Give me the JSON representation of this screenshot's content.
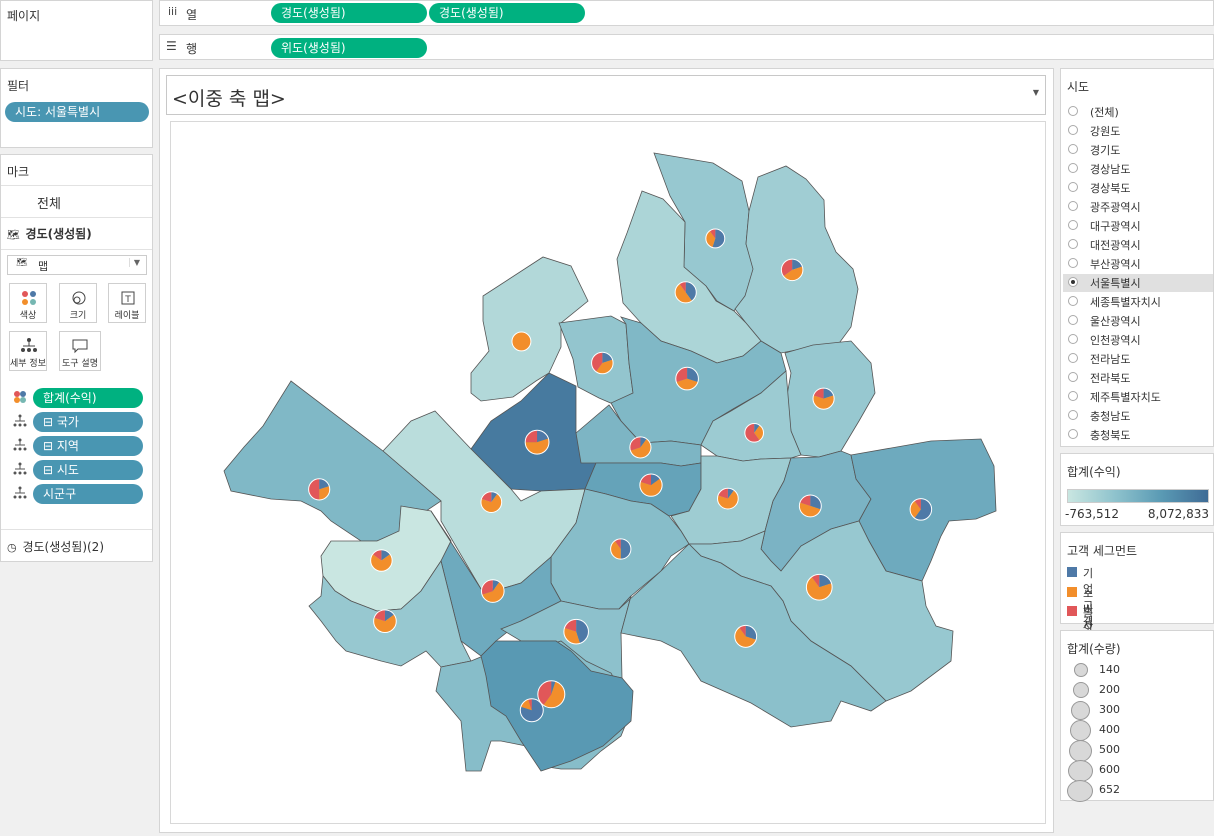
{
  "pages": {
    "label": "페이지"
  },
  "filters": {
    "title": "필터",
    "items": [
      "시도: 서울특별시"
    ]
  },
  "marks": {
    "title": "마크",
    "all_label": "전체",
    "layer_label": "경도(생성됨)",
    "mark_type": "맵",
    "buttons": [
      "색상",
      "크기",
      "레이블",
      "세부 정보",
      "도구 설명"
    ],
    "fields": [
      "합계(수익)",
      "⊟ 국가",
      "⊟ 지역",
      "⊟ 시도",
      "시군구"
    ],
    "footer_label": "경도(생성됨)(2)"
  },
  "columns": {
    "label": "열",
    "pills": [
      "경도(생성됨)",
      "경도(생성됨)"
    ]
  },
  "rows": {
    "label": "행",
    "pills": [
      "위도(생성됨)"
    ]
  },
  "sheet": {
    "title": "<이중 축 맵>"
  },
  "sido_filter": {
    "title": "시도",
    "options": [
      "(전체)",
      "강원도",
      "경기도",
      "경상남도",
      "경상북도",
      "광주광역시",
      "대구광역시",
      "대전광역시",
      "부산광역시",
      "서울특별시",
      "세종특별자치시",
      "울산광역시",
      "인천광역시",
      "전라남도",
      "전라북도",
      "제주특별자치도",
      "충청남도",
      "충청북도"
    ],
    "selected": "서울특별시"
  },
  "profit_legend": {
    "title": "합계(수익)",
    "min": "-763,512",
    "max": "8,072,833",
    "color_low": "#c9e6e1",
    "color_high": "#4a7096"
  },
  "segment_legend": {
    "title": "고객 세그먼트",
    "items": [
      {
        "label": "기업 고객",
        "color": "#4e79a7"
      },
      {
        "label": "소비자",
        "color": "#f28e2b"
      },
      {
        "label": "홈 오피스",
        "color": "#e15759"
      }
    ]
  },
  "quantity_legend": {
    "title": "합계(수량)",
    "items": [
      "140",
      "200",
      "300",
      "400",
      "500",
      "600",
      "652"
    ]
  },
  "colors": {
    "accent_green": "#00b180",
    "pill_blue": "#4996b2"
  },
  "chart_data": {
    "type": "map",
    "segments": [
      "기업 고객",
      "소비자",
      "홈 오피스"
    ],
    "districts": [
      {
        "profit": 1800000,
        "pie": [
          0.55,
          0.35,
          0.1
        ],
        "qty": 180
      },
      {
        "profit": 1300000,
        "pie": [
          0.2,
          0.45,
          0.35
        ],
        "qty": 300
      },
      {
        "profit": 700000,
        "pie": [
          0.4,
          0.5,
          0.1
        ],
        "qty": 280
      },
      {
        "profit": 400000,
        "pie": [
          0.0,
          1.0,
          0.0
        ],
        "qty": 180
      },
      {
        "profit": 2000000,
        "pie": [
          0.2,
          0.4,
          0.4
        ],
        "qty": 300
      },
      {
        "profit": 3000000,
        "pie": [
          0.3,
          0.4,
          0.3
        ],
        "qty": 360
      },
      {
        "profit": 1800000,
        "pie": [
          0.2,
          0.6,
          0.2
        ],
        "qty": 280
      },
      {
        "profit": 1500000,
        "pie": [
          0.1,
          0.3,
          0.6
        ],
        "qty": 170
      },
      {
        "profit": 7200000,
        "pie": [
          0.2,
          0.55,
          0.25
        ],
        "qty": 430
      },
      {
        "profit": 0,
        "pie": [
          0.1,
          0.7,
          0.2
        ],
        "qty": 260
      },
      {
        "profit": 3200000,
        "pie": [
          0.1,
          0.6,
          0.3
        ],
        "qty": 280
      },
      {
        "profit": 3000000,
        "pie": [
          0.2,
          0.3,
          0.5
        ],
        "qty": 280
      },
      {
        "profit": 4500000,
        "pie": [
          0.15,
          0.65,
          0.2
        ],
        "qty": 340
      },
      {
        "profit": 1400000,
        "pie": [
          0.1,
          0.7,
          0.2
        ],
        "qty": 260
      },
      {
        "profit": 3300000,
        "pie": [
          0.3,
          0.5,
          0.2
        ],
        "qty": 320
      },
      {
        "profit": 4000000,
        "pie": [
          0.6,
          0.3,
          0.1
        ],
        "qty": 300
      },
      {
        "profit": 2600000,
        "pie": [
          0.5,
          0.4,
          0.1
        ],
        "qty": 240
      },
      {
        "profit": -763512,
        "pie": [
          0.15,
          0.7,
          0.15
        ],
        "qty": 300
      },
      {
        "profit": 4000000,
        "pie": [
          0.1,
          0.6,
          0.3
        ],
        "qty": 360
      },
      {
        "profit": 1800000,
        "pie": [
          0.2,
          0.7,
          0.1
        ],
        "qty": 560
      },
      {
        "profit": 2300000,
        "pie": [
          0.45,
          0.35,
          0.2
        ],
        "qty": 480
      },
      {
        "profit": 2400000,
        "pie": [
          0.3,
          0.6,
          0.1
        ],
        "qty": 320
      },
      {
        "profit": 1800000,
        "pie": [
          0.15,
          0.65,
          0.2
        ],
        "qty": 360
      },
      {
        "profit": 2600000,
        "pie": [
          0.8,
          0.15,
          0.05
        ],
        "qty": 380
      },
      {
        "profit": 5200000,
        "pie": [
          0.05,
          0.55,
          0.4
        ],
        "qty": 652
      }
    ]
  }
}
